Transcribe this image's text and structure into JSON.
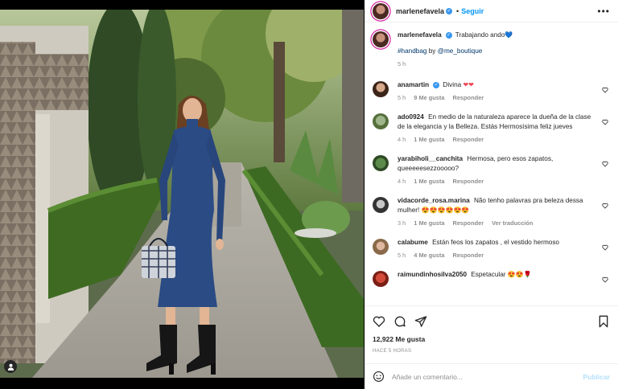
{
  "post": {
    "author": "marlenefavela",
    "follow_label": "Seguir",
    "more_label": "•••",
    "caption_text": "Trabajando ando",
    "caption_emoji": "💙",
    "caption_line2_hashtag": "#handbag",
    "caption_line2_by": "by",
    "caption_line2_mention": "@me_boutique",
    "caption_time": "5 h"
  },
  "comments": [
    {
      "user": "anamartin",
      "verified": true,
      "text": "Divina",
      "emoji": "❤❤",
      "time": "5 h",
      "likes": "9 Me gusta",
      "reply": "Responder",
      "translate": ""
    },
    {
      "user": "ado0924",
      "verified": false,
      "text": "En medio de la naturaleza aparece la dueña de la clase de la elegancia y la Belleza. Estás Hermosísima feliz jueves",
      "emoji": "",
      "time": "4 h",
      "likes": "1 Me gusta",
      "reply": "Responder",
      "translate": ""
    },
    {
      "user": "yarabiholi__canchita",
      "verified": false,
      "text": "Hermosa, pero esos zapatos, queeeeesezzooooo?",
      "emoji": "",
      "time": "4 h",
      "likes": "1 Me gusta",
      "reply": "Responder",
      "translate": ""
    },
    {
      "user": "vidacorde_rosa.marina",
      "verified": false,
      "text": "Não tenho palavras pra beleza dessa mulher!",
      "emoji": "😍😍😍😍😍😍",
      "time": "3 h",
      "likes": "1 Me gusta",
      "reply": "Responder",
      "translate": "Ver traducción"
    },
    {
      "user": "calabume",
      "verified": false,
      "text": "Están feos los zapatos , el vestido hermoso",
      "emoji": "",
      "time": "5 h",
      "likes": "4 Me gusta",
      "reply": "Responder",
      "translate": ""
    },
    {
      "user": "raimundinhosilva2050",
      "verified": false,
      "text": "Espetacular",
      "emoji": "😍😍🌹",
      "time": "",
      "likes": "",
      "reply": "",
      "translate": ""
    }
  ],
  "actions": {
    "likes_count": "12,922 Me gusta",
    "time_ago": "HACE 5 HORAS"
  },
  "composer": {
    "placeholder": "Añade un comentario...",
    "publish_label": "Publicar"
  },
  "colors": {
    "accent": "#0095f6",
    "verified": "#3897f0",
    "heart": "#ed4956",
    "dress": "#2a4b84"
  }
}
